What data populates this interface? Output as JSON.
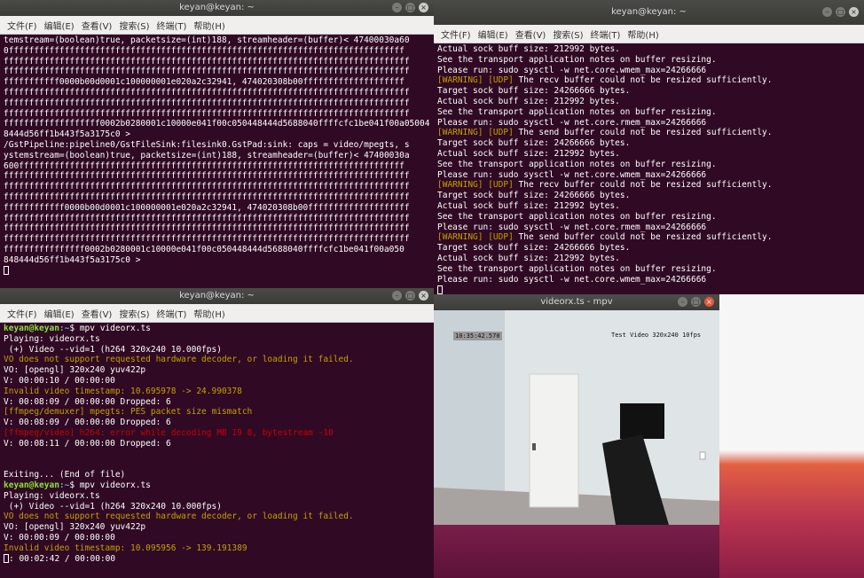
{
  "win_top_left": {
    "title": "keyan@keyan: ~",
    "menu": [
      "文件(F)",
      "编辑(E)",
      "查看(V)",
      "搜索(S)",
      "终端(T)",
      "帮助(H)"
    ],
    "lines": [
      "temstream=(boolean)true, packetsize=(int)188, streamheader=(buffer)< 47400030a60",
      "0ffffffffffffffffffffffffffffffffffffffffffffffffffffffffffffffffffffffffffffff",
      "ffffffffffffffffffffffffffffffffffffffffffffffffffffffffffffffffffffffffffffffff",
      "ffffffffffffffffffffffffffffffffffffffffffffffffffffffffffffffffffffffffffffffff",
      "fffffffffff0000b00d0001c100000001e020a2c32941, 474020308b00ffffffffffffffffffff",
      "ffffffffffffffffffffffffffffffffffffffffffffffffffffffffffffffffffffffffffffffff",
      "ffffffffffffffffffffffffffffffffffffffffffffffffffffffffffffffffffffffffffffffff",
      "ffffffffffffffffffffffffffffffffffffffffffffffffffffffffffffffffffffffffffffffff",
      "fffffffffffffffffff0002b0280001c10000e041f00c050448444d5688040ffffcfc1be041f00a05004",
      "8444d56ff1b443f5a3175c0 >",
      "/GstPipeline:pipeline0/GstFileSink:filesink0.GstPad:sink: caps = video/mpegts, s",
      "ystemstream=(boolean)true, packetsize=(int)188, streamheader=(buffer)< 47400030a",
      "600ffffffffffffffffffffffffffffffffffffffffffffffffffffffffffffffffffffffffffff",
      "ffffffffffffffffffffffffffffffffffffffffffffffffffffffffffffffffffffffffffffffff",
      "ffffffffffffffffffffffffffffffffffffffffffffffffffffffffffffffffffffffffffffffff",
      "ffffffffffffffffffffffffffffffffffffffffffffffffffffffffffffffffffffffffffffffff",
      "ffffffffffff0000b00d0001c100000001e020a2c32941, 474020308b00ffffffffffffffffffff",
      "ffffffffffffffffffffffffffffffffffffffffffffffffffffffffffffffffffffffffffffffff",
      "ffffffffffffffffffffffffffffffffffffffffffffffffffffffffffffffffffffffffffffffff",
      "ffffffffffffffffffffffffffffffffffffffffffffffffffffffffffffffffffffffffffffffff",
      "ffffffffffffffff0002b0280001c10000e041f00c050448444d5688040ffffcfc1be041f00a050",
      "848444d56ff1b443f5a3175c0 >"
    ]
  },
  "win_top_right": {
    "title": "keyan@keyan: ~",
    "menu": [
      "文件(F)",
      "编辑(E)",
      "查看(V)",
      "搜索(S)",
      "终端(T)",
      "帮助(H)"
    ],
    "lines": [
      {
        "t": "Actual sock buff size: 212992 bytes.",
        "c": ""
      },
      {
        "t": "See the transport application notes on buffer resizing.",
        "c": ""
      },
      {
        "t": "Please run: sudo sysctl -w net.core.wmem_max=24266666",
        "c": ""
      },
      {
        "t": "[WARNING] [UDP] The recv buffer could not be resized sufficiently.",
        "c": "warnpre"
      },
      {
        "t": "Target sock buff size: 24266666 bytes.",
        "c": ""
      },
      {
        "t": "Actual sock buff size: 212992 bytes.",
        "c": ""
      },
      {
        "t": "See the transport application notes on buffer resizing.",
        "c": ""
      },
      {
        "t": "Please run: sudo sysctl -w net.core.rmem_max=24266666",
        "c": ""
      },
      {
        "t": "[WARNING] [UDP] The send buffer could not be resized sufficiently.",
        "c": "warnpre"
      },
      {
        "t": "Target sock buff size: 24266666 bytes.",
        "c": ""
      },
      {
        "t": "Actual sock buff size: 212992 bytes.",
        "c": ""
      },
      {
        "t": "See the transport application notes on buffer resizing.",
        "c": ""
      },
      {
        "t": "Please run: sudo sysctl -w net.core.wmem_max=24266666",
        "c": ""
      },
      {
        "t": "[WARNING] [UDP] The recv buffer could not be resized sufficiently.",
        "c": "warnpre"
      },
      {
        "t": "Target sock buff size: 24266666 bytes.",
        "c": ""
      },
      {
        "t": "Actual sock buff size: 212992 bytes.",
        "c": ""
      },
      {
        "t": "See the transport application notes on buffer resizing.",
        "c": ""
      },
      {
        "t": "Please run: sudo sysctl -w net.core.rmem_max=24266666",
        "c": ""
      },
      {
        "t": "[WARNING] [UDP] The send buffer could not be resized sufficiently.",
        "c": "warnpre"
      },
      {
        "t": "Target sock buff size: 24266666 bytes.",
        "c": ""
      },
      {
        "t": "Actual sock buff size: 212992 bytes.",
        "c": ""
      },
      {
        "t": "See the transport application notes on buffer resizing.",
        "c": ""
      },
      {
        "t": "Please run: sudo sysctl -w net.core.wmem_max=24266666",
        "c": ""
      }
    ],
    "warn_prefix": "[WARNING] [UDP]"
  },
  "win_bottom_left": {
    "title": "keyan@keyan: ~",
    "menu": [
      "文件(F)",
      "编辑(E)",
      "查看(V)",
      "搜索(S)",
      "终端(T)",
      "帮助(H)"
    ],
    "lines": [
      {
        "t": "mpv videorx.ts",
        "c": "prompt"
      },
      {
        "t": "Playing: videorx.ts",
        "c": ""
      },
      {
        "t": " (+) Video --vid=1 (h264 320x240 10.000fps)",
        "c": ""
      },
      {
        "t": "VO does not support requested hardware decoder, or loading it failed.",
        "c": "warn"
      },
      {
        "t": "VO: [opengl] 320x240 yuv422p",
        "c": ""
      },
      {
        "t": "V: 00:00:10 / 00:00:00",
        "c": ""
      },
      {
        "t": "Invalid video timestamp: 10.695978 -> 24.990378",
        "c": "warn"
      },
      {
        "t": "V: 00:08:09 / 00:00:00 Dropped: 6",
        "c": ""
      },
      {
        "t": "[ffmpeg/demuxer] mpegts: PES packet size mismatch",
        "c": "warn"
      },
      {
        "t": "V: 00:08:09 / 00:00:00 Dropped: 6",
        "c": ""
      },
      {
        "t": "[ffmpeg/video] h264: error while decoding MB 19 8, bytestream -10",
        "c": "err"
      },
      {
        "t": "V: 00:08:11 / 00:00:00 Dropped: 6",
        "c": ""
      },
      {
        "t": "",
        "c": ""
      },
      {
        "t": "",
        "c": ""
      },
      {
        "t": "Exiting... (End of file)",
        "c": ""
      },
      {
        "t": "mpv videorx.ts",
        "c": "prompt"
      },
      {
        "t": "Playing: videorx.ts",
        "c": ""
      },
      {
        "t": " (+) Video --vid=1 (h264 320x240 10.000fps)",
        "c": ""
      },
      {
        "t": "VO does not support requested hardware decoder, or loading it failed.",
        "c": "warn"
      },
      {
        "t": "VO: [opengl] 320x240 yuv422p",
        "c": ""
      },
      {
        "t": "V: 00:00:09 / 00:00:00",
        "c": ""
      },
      {
        "t": "Invalid video timestamp: 10.095956 -> 139.191389",
        "c": "warn"
      },
      {
        "t": "V: 00:02:42 / 00:00:00",
        "c": "cursorline"
      }
    ],
    "prompt_user": "keyan@keyan",
    "prompt_path": ":~",
    "prompt_sym": "$ "
  },
  "mpv": {
    "title": "videorx.ts - mpv",
    "osd_time": "10:35:42.570",
    "osd_text": "Test Video 320x240 10fps"
  },
  "colors": {
    "terminal_bg": "#300a24",
    "warning": "#c4a000",
    "error": "#cc0000",
    "prompt": "#8ae234",
    "path": "#729fcf"
  }
}
